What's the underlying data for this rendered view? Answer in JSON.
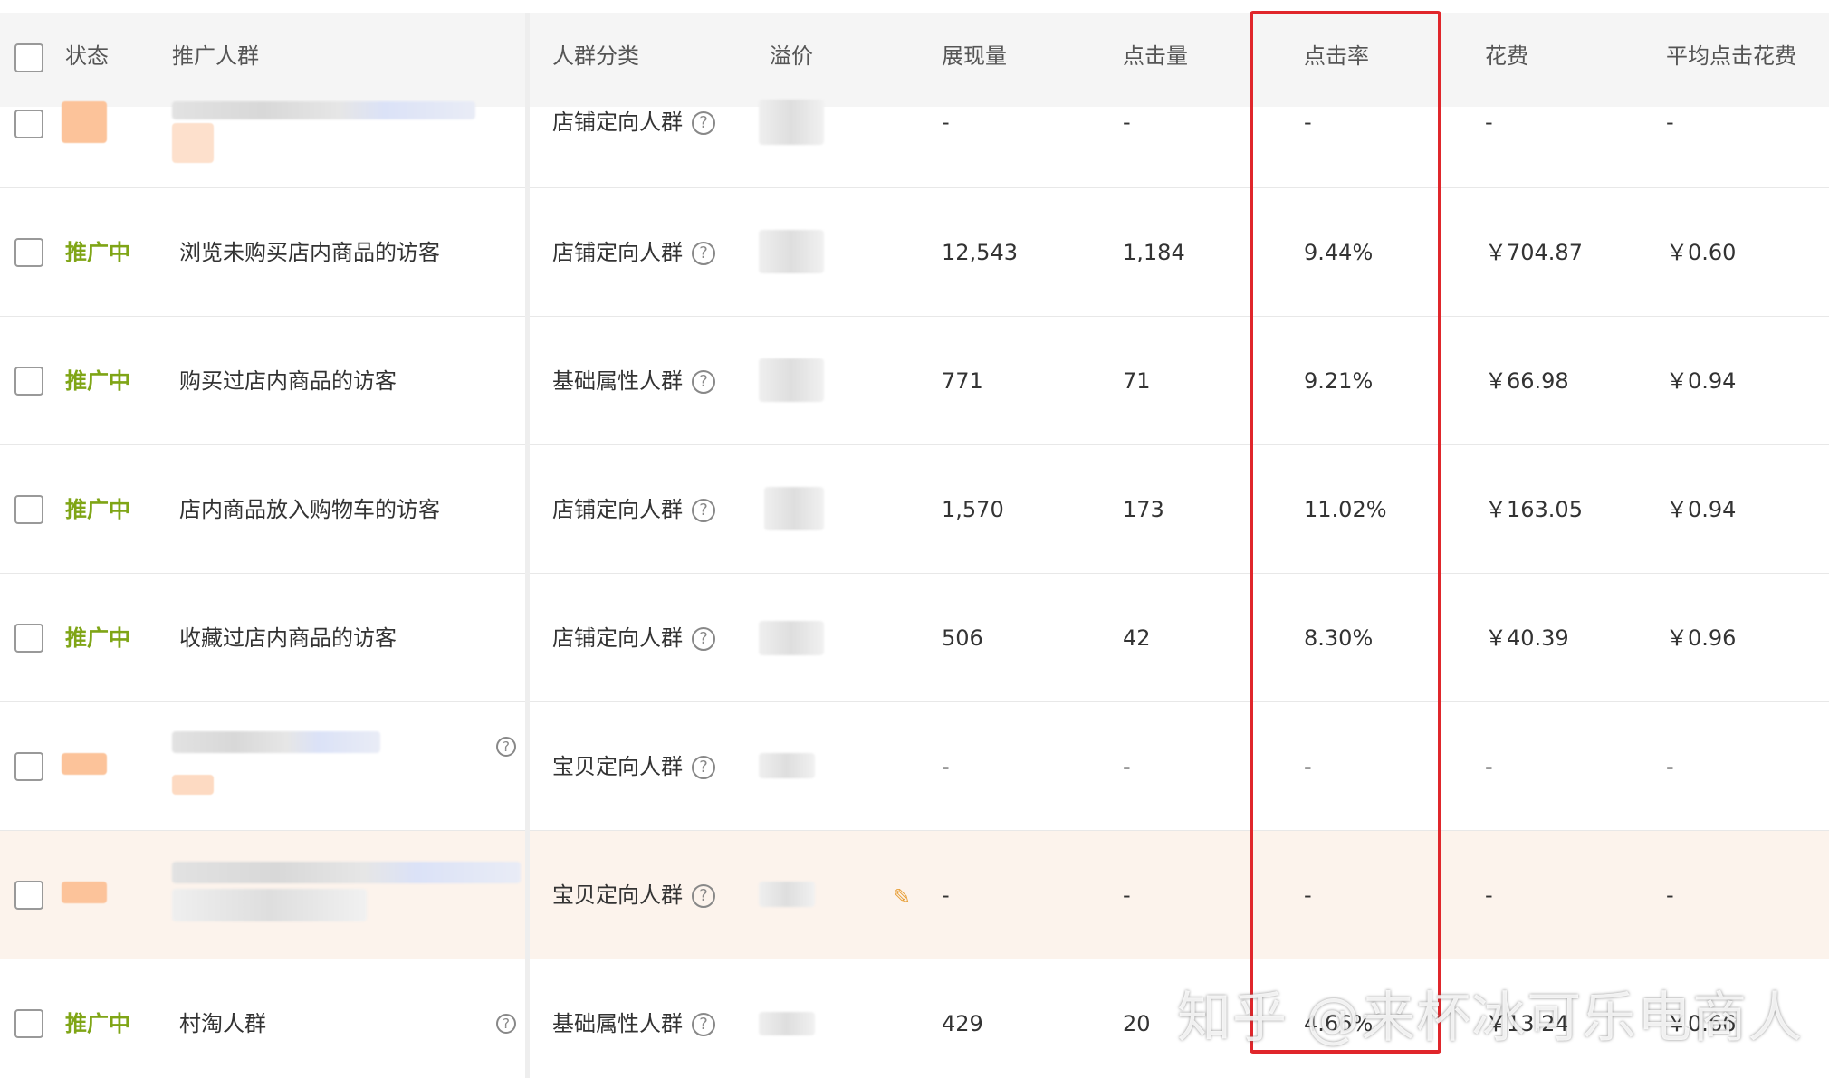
{
  "header": {
    "status": "状态",
    "audience": "推广人群",
    "category": "人群分类",
    "premium": "溢价",
    "impressions": "展现量",
    "clicks": "点击量",
    "ctr": "点击率",
    "cost": "花费",
    "avg_cpc": "平均点击花费"
  },
  "rows": [
    {
      "status": "",
      "audience": "",
      "category": "店铺定向人群",
      "impressions": "-",
      "clicks": "-",
      "ctr": "-",
      "cost": "-",
      "avg_cpc": "-"
    },
    {
      "status": "推广中",
      "audience": "浏览未购买店内商品的访客",
      "category": "店铺定向人群",
      "impressions": "12,543",
      "clicks": "1,184",
      "ctr": "9.44%",
      "cost": "￥704.87",
      "avg_cpc": "￥0.60"
    },
    {
      "status": "推广中",
      "audience": "购买过店内商品的访客",
      "category": "基础属性人群",
      "impressions": "771",
      "clicks": "71",
      "ctr": "9.21%",
      "cost": "￥66.98",
      "avg_cpc": "￥0.94"
    },
    {
      "status": "推广中",
      "audience": "店内商品放入购物车的访客",
      "category": "店铺定向人群",
      "impressions": "1,570",
      "clicks": "173",
      "ctr": "11.02%",
      "cost": "￥163.05",
      "avg_cpc": "￥0.94"
    },
    {
      "status": "推广中",
      "audience": "收藏过店内商品的访客",
      "category": "店铺定向人群",
      "impressions": "506",
      "clicks": "42",
      "ctr": "8.30%",
      "cost": "￥40.39",
      "avg_cpc": "￥0.96"
    },
    {
      "status": "",
      "audience": "",
      "category": "宝贝定向人群",
      "impressions": "-",
      "clicks": "-",
      "ctr": "-",
      "cost": "-",
      "avg_cpc": "-"
    },
    {
      "status": "",
      "audience": "",
      "category": "宝贝定向人群",
      "impressions": "-",
      "clicks": "-",
      "ctr": "-",
      "cost": "-",
      "avg_cpc": "-"
    },
    {
      "status": "推广中",
      "audience": "村淘人群",
      "category": "基础属性人群",
      "impressions": "429",
      "clicks": "20",
      "ctr": "4.66%",
      "cost": "￥13.24",
      "avg_cpc": "￥0.66"
    }
  ],
  "watermark": "知乎 @来杯冰可乐电商人",
  "icons": {
    "help": "question-circle-icon",
    "edit": "pencil-icon"
  },
  "colors": {
    "status_active": "#7fa516",
    "highlight_row": "#fcf3ec",
    "red_box": "#e0262b"
  }
}
